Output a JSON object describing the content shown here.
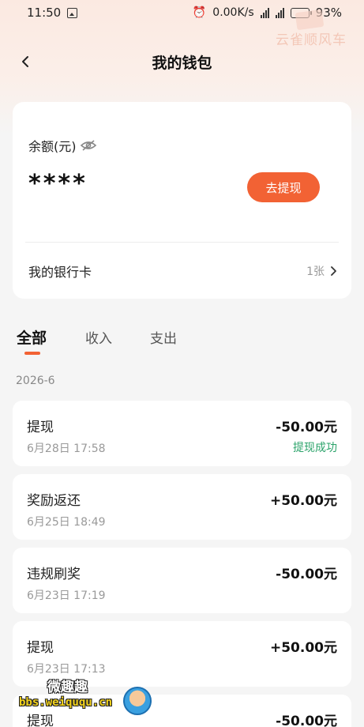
{
  "status_bar": {
    "time": "11:50",
    "net_speed": "0.00K/s",
    "battery": "93%",
    "icons": [
      "image-icon",
      "alarm-icon",
      "signal-4g-icon",
      "signal-4g-icon",
      "battery-icon"
    ]
  },
  "header": {
    "title": "我的钱包",
    "brand": "云雀顺风车"
  },
  "balance_card": {
    "label": "余额(元)",
    "value": "****",
    "withdraw_button": "去提现",
    "bank_label": "我的银行卡",
    "bank_count": "1张"
  },
  "tabs": [
    {
      "label": "全部",
      "active": true
    },
    {
      "label": "收入",
      "active": false
    },
    {
      "label": "支出",
      "active": false
    }
  ],
  "month": "2026-6",
  "transactions": [
    {
      "title": "提现",
      "time": "6月28日 17:58",
      "amount": "-50.00元",
      "status": "提现成功"
    },
    {
      "title": "奖励返还",
      "time": "6月25日 18:49",
      "amount": "+50.00元",
      "status": ""
    },
    {
      "title": "违规刷奖",
      "time": "6月23日 17:19",
      "amount": "-50.00元",
      "status": ""
    },
    {
      "title": "提现",
      "time": "6月23日 17:13",
      "amount": "+50.00元",
      "status": ""
    },
    {
      "title": "提现",
      "time": "",
      "amount": "-50.00元",
      "status": ""
    }
  ],
  "watermark": {
    "cn": "微趣趣",
    "url": "bbs.weiququ.cn"
  },
  "colors": {
    "accent": "#f26234",
    "success": "#2ba36a",
    "background": "#f5f5f5"
  }
}
